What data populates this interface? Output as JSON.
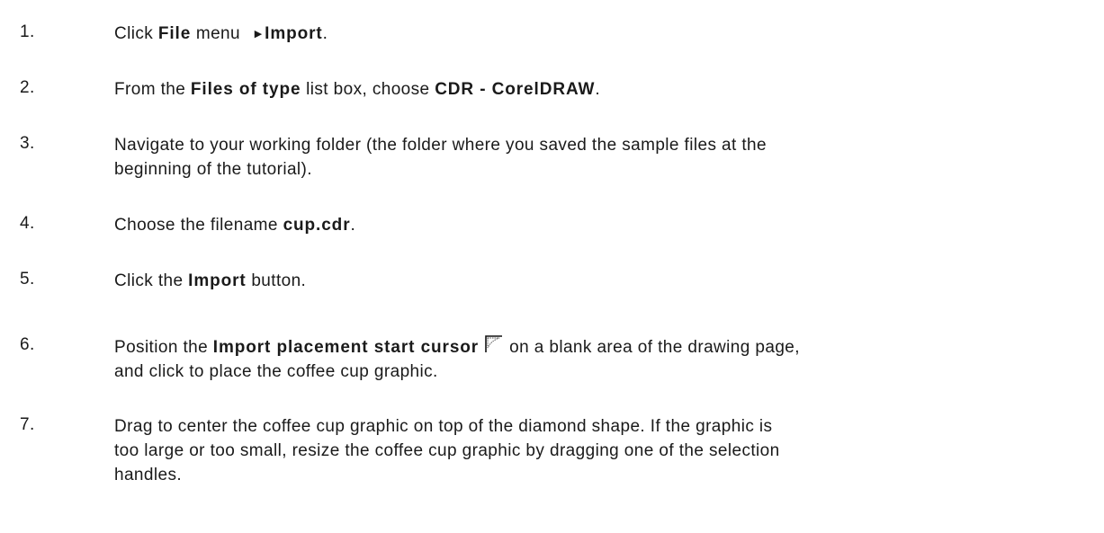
{
  "steps": [
    {
      "number": "1.",
      "parts": [
        {
          "t": "Click "
        },
        {
          "b": "File"
        },
        {
          "t": " menu "
        },
        {
          "arrow": true
        },
        {
          "b": "Import"
        },
        {
          "t": "."
        }
      ]
    },
    {
      "number": "2.",
      "parts": [
        {
          "t": "From the "
        },
        {
          "b": "Files of type"
        },
        {
          "t": " list box, choose "
        },
        {
          "b": "CDR - CorelDRAW"
        },
        {
          "t": "."
        }
      ]
    },
    {
      "number": "3.",
      "parts": [
        {
          "t": "Navigate to your working folder (the folder where you saved the sample files at the "
        },
        {
          "br": true
        },
        {
          "t": "beginning of the tutorial)."
        }
      ]
    },
    {
      "number": "4.",
      "parts": [
        {
          "t": "Choose the filename "
        },
        {
          "b": "cup.cdr"
        },
        {
          "t": "."
        }
      ]
    },
    {
      "number": "5.",
      "parts": [
        {
          "t": "Click the "
        },
        {
          "b": "Import"
        },
        {
          "t": " button."
        }
      ]
    },
    {
      "number": "6.",
      "parts": [
        {
          "t": "Position the "
        },
        {
          "b": "Import placement start cursor"
        },
        {
          "icon": "import-placement-cursor-icon"
        },
        {
          "t": "on a blank area of the drawing page,"
        },
        {
          "br": true
        },
        {
          "t": "and click to place the coffee cup graphic."
        }
      ]
    },
    {
      "number": "7.",
      "parts": [
        {
          "t": "Drag to center the coffee cup graphic on top of the diamond shape. If the graphic is "
        },
        {
          "br": true
        },
        {
          "t": "too large or too small, resize the coffee cup graphic by dragging one of the selection "
        },
        {
          "br": true
        },
        {
          "t": "handles."
        }
      ]
    }
  ]
}
